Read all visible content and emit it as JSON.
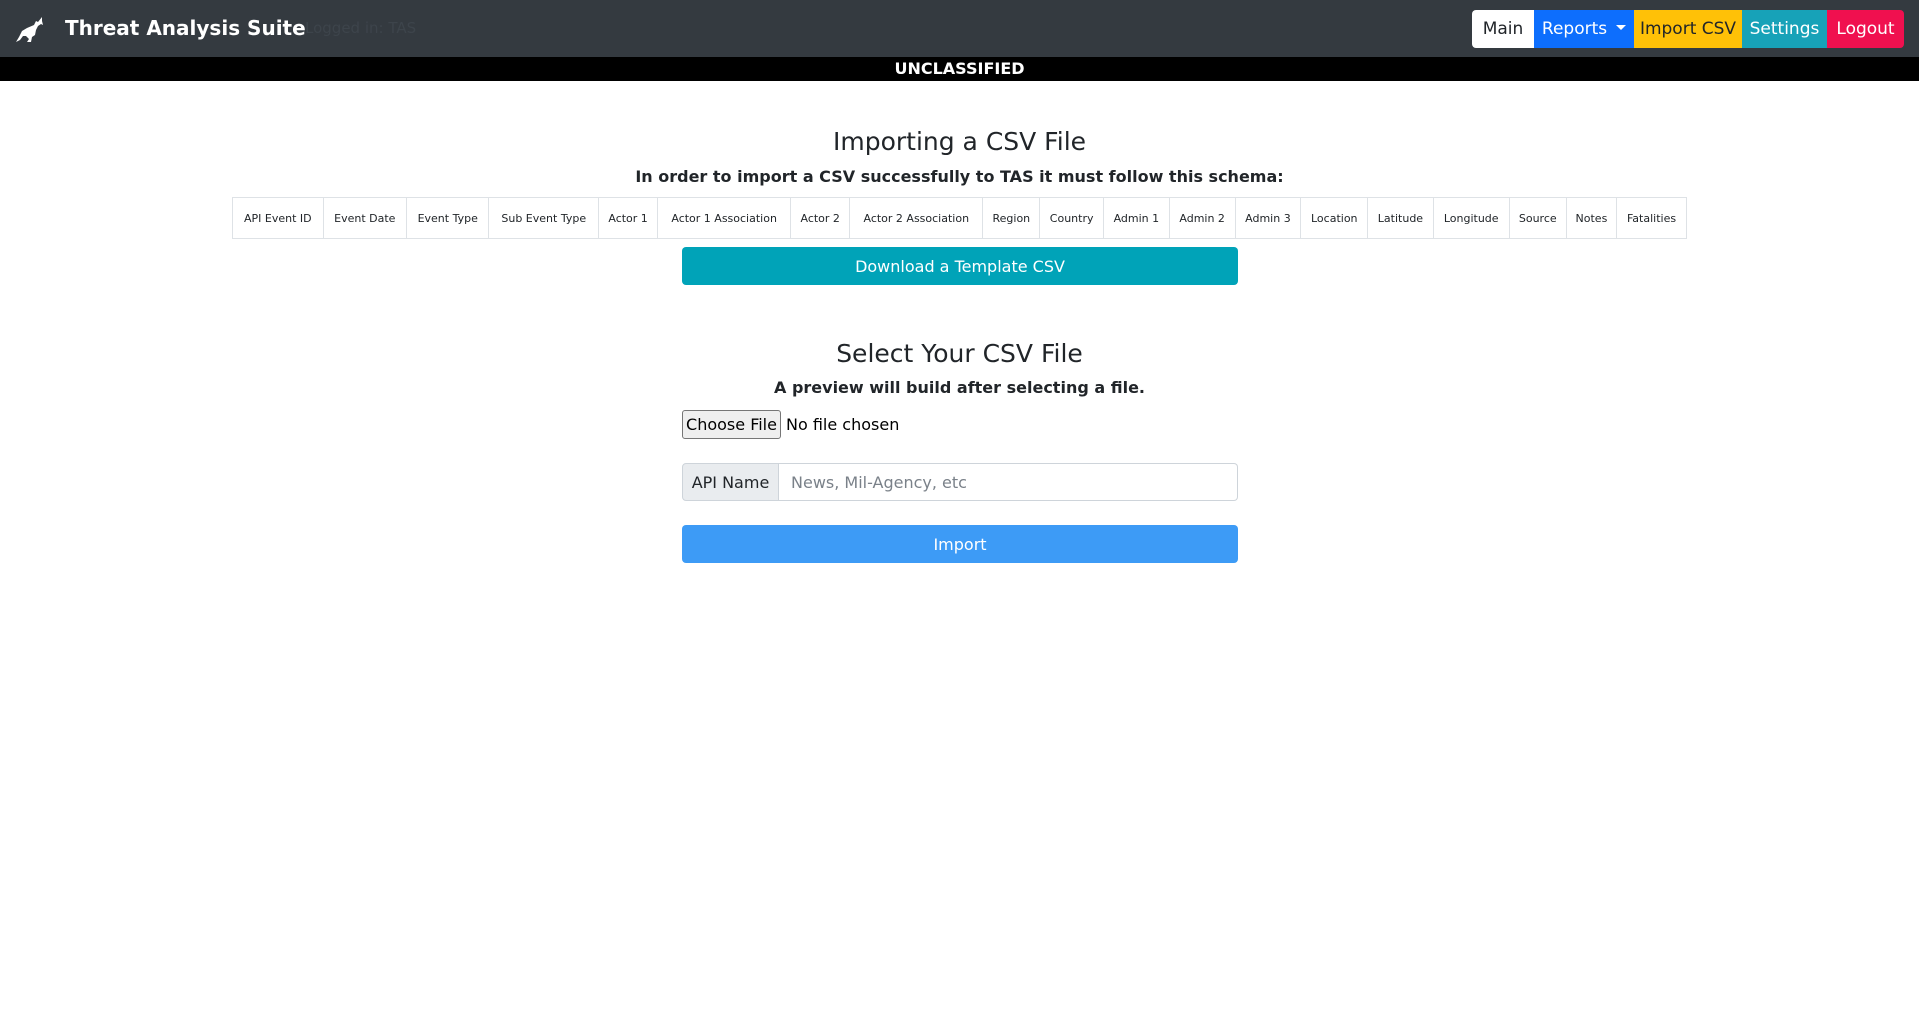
{
  "navbar": {
    "title": "Threat Analysis Suite",
    "subtitle": "Logged in: TAS",
    "buttons": {
      "main": "Main",
      "reports": "Reports",
      "import_csv": "Import CSV",
      "settings": "Settings",
      "logout": "Logout"
    },
    "icon": "wolf-logo-icon"
  },
  "banner": {
    "text": "UNCLASSIFIED",
    "color": "#000000"
  },
  "import_section": {
    "heading": "Importing a CSV File",
    "subheading": "In order to import a CSV successfully to TAS it must follow this schema:",
    "schema_columns": [
      "API Event ID",
      "Event Date",
      "Event Type",
      "Sub Event Type",
      "Actor 1",
      "Actor 1 Association",
      "Actor 2",
      "Actor 2 Association",
      "Region",
      "Country",
      "Admin 1",
      "Admin 2",
      "Admin 3",
      "Location",
      "Latitude",
      "Longitude",
      "Source",
      "Notes",
      "Fatalities"
    ],
    "download_button": "Download a Template CSV"
  },
  "select_section": {
    "heading": "Select Your CSV File",
    "subheading": "A preview will build after selecting a file.",
    "choose_button": "Choose File",
    "file_status": "No file chosen",
    "api_label": "API Name",
    "api_placeholder": "News, Mil-Agency, etc",
    "import_button": "Import"
  },
  "colors": {
    "navbar": "#343a40",
    "reports": "#0d6efd",
    "import_csv": "#ffc107",
    "settings": "#17a2b8",
    "logout": "#f0104f",
    "download": "#00a3b8",
    "import": "#3d9bf6"
  }
}
